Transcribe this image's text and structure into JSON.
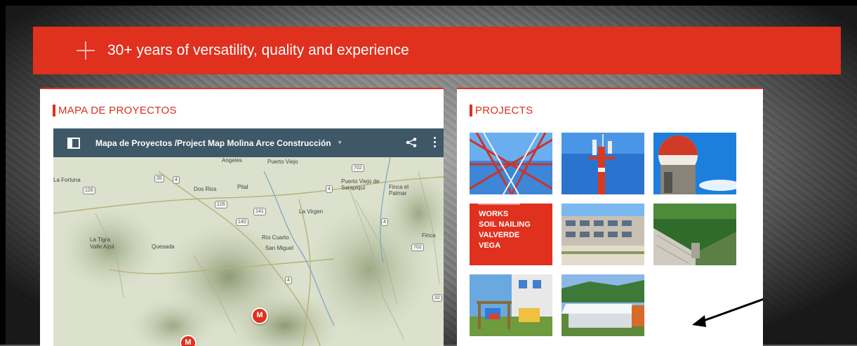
{
  "banner": {
    "text": "30+ years of versatility, quality and experience"
  },
  "left_panel": {
    "title": "MAPA DE PROYECTOS",
    "map": {
      "title": "Mapa de Proyectos /Project Map Molina Arce Construcción",
      "labels": [
        "Angeles",
        "Puerto Viejo",
        "Puerto Viejo de Sarapiquí",
        "Finca el Palmar",
        "La Fortuna",
        "Dos Rios",
        "Pital",
        "La Virgen",
        "Río Cuarto",
        "San Miguel",
        "Quesada",
        "La Tigra",
        "Valle Azul",
        "Finca"
      ],
      "road_markers": [
        "126",
        "35",
        "4",
        "140",
        "141",
        "4",
        "126",
        "702",
        "4",
        "702",
        "4",
        "32"
      ]
    }
  },
  "right_panel": {
    "title": "PROJECTS",
    "tiles": [
      {
        "text": "",
        "image": "lattice-tower-photo"
      },
      {
        "text": "",
        "image": "red-antenna-tower-photo"
      },
      {
        "text": "",
        "image": "radar-dome-photo"
      },
      {
        "text": "WORKS\nSOIL NAILING\nVALVERDE\nVEGA",
        "image": "red-text-tile"
      },
      {
        "text": "",
        "image": "building-facade-photo"
      },
      {
        "text": "",
        "image": "concrete-dam-photo"
      },
      {
        "text": "",
        "image": "playground-photo"
      },
      {
        "text": "",
        "image": "covered-court-photo"
      }
    ]
  },
  "colors": {
    "accent": "#e0301e",
    "map_header": "#3f5867"
  }
}
